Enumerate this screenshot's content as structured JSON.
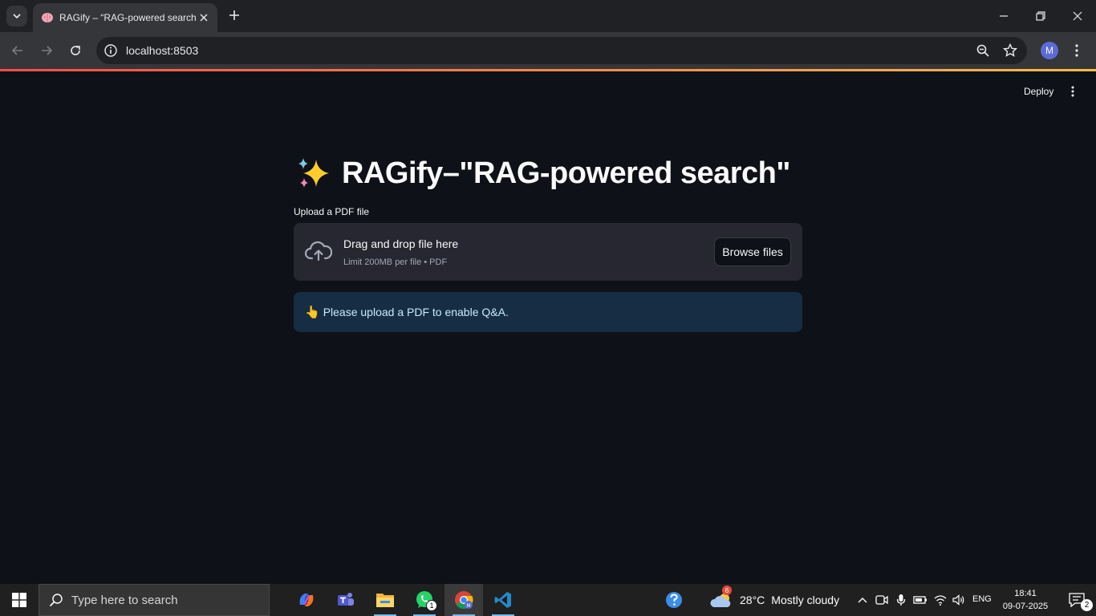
{
  "browser": {
    "tab_title": "RAGify – “RAG-powered search",
    "url": "localhost:8503",
    "profile_initial": "M"
  },
  "app": {
    "deploy_label": "Deploy",
    "title": "RAGify–\"RAG-powered search\"",
    "upload_label": "Upload a PDF file",
    "dropzone_text": "Drag and drop file here",
    "dropzone_limit": "Limit 200MB per file • PDF",
    "browse_label": "Browse files",
    "info_emoji": "👆",
    "info_message": "Please upload a PDF to enable Q&A."
  },
  "taskbar": {
    "search_placeholder": "Type here to search",
    "whatsapp_badge": "1",
    "weather_badge": "6",
    "weather_temp": "28°C",
    "weather_condition": "Mostly cloudy",
    "language": "ENG",
    "time": "18:41",
    "date": "09-07-2025",
    "notification_count": "2"
  },
  "colors": {
    "app_bg": "#0e1117",
    "dropzone_bg": "#262730",
    "info_bg": "#172d43",
    "info_text": "#c7ebff",
    "accent_gradient_start": "#ff4b4b",
    "accent_gradient_end": "#ffbd45"
  }
}
